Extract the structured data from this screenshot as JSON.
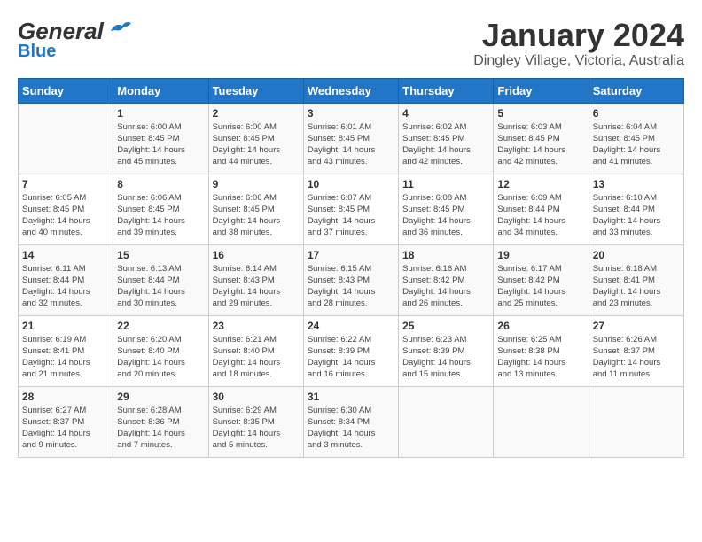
{
  "header": {
    "logo_general": "General",
    "logo_blue": "Blue",
    "month": "January 2024",
    "location": "Dingley Village, Victoria, Australia"
  },
  "weekdays": [
    "Sunday",
    "Monday",
    "Tuesday",
    "Wednesday",
    "Thursday",
    "Friday",
    "Saturday"
  ],
  "weeks": [
    [
      {
        "day": "",
        "content": ""
      },
      {
        "day": "1",
        "content": "Sunrise: 6:00 AM\nSunset: 8:45 PM\nDaylight: 14 hours\nand 45 minutes."
      },
      {
        "day": "2",
        "content": "Sunrise: 6:00 AM\nSunset: 8:45 PM\nDaylight: 14 hours\nand 44 minutes."
      },
      {
        "day": "3",
        "content": "Sunrise: 6:01 AM\nSunset: 8:45 PM\nDaylight: 14 hours\nand 43 minutes."
      },
      {
        "day": "4",
        "content": "Sunrise: 6:02 AM\nSunset: 8:45 PM\nDaylight: 14 hours\nand 42 minutes."
      },
      {
        "day": "5",
        "content": "Sunrise: 6:03 AM\nSunset: 8:45 PM\nDaylight: 14 hours\nand 42 minutes."
      },
      {
        "day": "6",
        "content": "Sunrise: 6:04 AM\nSunset: 8:45 PM\nDaylight: 14 hours\nand 41 minutes."
      }
    ],
    [
      {
        "day": "7",
        "content": "Sunrise: 6:05 AM\nSunset: 8:45 PM\nDaylight: 14 hours\nand 40 minutes."
      },
      {
        "day": "8",
        "content": "Sunrise: 6:06 AM\nSunset: 8:45 PM\nDaylight: 14 hours\nand 39 minutes."
      },
      {
        "day": "9",
        "content": "Sunrise: 6:06 AM\nSunset: 8:45 PM\nDaylight: 14 hours\nand 38 minutes."
      },
      {
        "day": "10",
        "content": "Sunrise: 6:07 AM\nSunset: 8:45 PM\nDaylight: 14 hours\nand 37 minutes."
      },
      {
        "day": "11",
        "content": "Sunrise: 6:08 AM\nSunset: 8:45 PM\nDaylight: 14 hours\nand 36 minutes."
      },
      {
        "day": "12",
        "content": "Sunrise: 6:09 AM\nSunset: 8:44 PM\nDaylight: 14 hours\nand 34 minutes."
      },
      {
        "day": "13",
        "content": "Sunrise: 6:10 AM\nSunset: 8:44 PM\nDaylight: 14 hours\nand 33 minutes."
      }
    ],
    [
      {
        "day": "14",
        "content": "Sunrise: 6:11 AM\nSunset: 8:44 PM\nDaylight: 14 hours\nand 32 minutes."
      },
      {
        "day": "15",
        "content": "Sunrise: 6:13 AM\nSunset: 8:44 PM\nDaylight: 14 hours\nand 30 minutes."
      },
      {
        "day": "16",
        "content": "Sunrise: 6:14 AM\nSunset: 8:43 PM\nDaylight: 14 hours\nand 29 minutes."
      },
      {
        "day": "17",
        "content": "Sunrise: 6:15 AM\nSunset: 8:43 PM\nDaylight: 14 hours\nand 28 minutes."
      },
      {
        "day": "18",
        "content": "Sunrise: 6:16 AM\nSunset: 8:42 PM\nDaylight: 14 hours\nand 26 minutes."
      },
      {
        "day": "19",
        "content": "Sunrise: 6:17 AM\nSunset: 8:42 PM\nDaylight: 14 hours\nand 25 minutes."
      },
      {
        "day": "20",
        "content": "Sunrise: 6:18 AM\nSunset: 8:41 PM\nDaylight: 14 hours\nand 23 minutes."
      }
    ],
    [
      {
        "day": "21",
        "content": "Sunrise: 6:19 AM\nSunset: 8:41 PM\nDaylight: 14 hours\nand 21 minutes."
      },
      {
        "day": "22",
        "content": "Sunrise: 6:20 AM\nSunset: 8:40 PM\nDaylight: 14 hours\nand 20 minutes."
      },
      {
        "day": "23",
        "content": "Sunrise: 6:21 AM\nSunset: 8:40 PM\nDaylight: 14 hours\nand 18 minutes."
      },
      {
        "day": "24",
        "content": "Sunrise: 6:22 AM\nSunset: 8:39 PM\nDaylight: 14 hours\nand 16 minutes."
      },
      {
        "day": "25",
        "content": "Sunrise: 6:23 AM\nSunset: 8:39 PM\nDaylight: 14 hours\nand 15 minutes."
      },
      {
        "day": "26",
        "content": "Sunrise: 6:25 AM\nSunset: 8:38 PM\nDaylight: 14 hours\nand 13 minutes."
      },
      {
        "day": "27",
        "content": "Sunrise: 6:26 AM\nSunset: 8:37 PM\nDaylight: 14 hours\nand 11 minutes."
      }
    ],
    [
      {
        "day": "28",
        "content": "Sunrise: 6:27 AM\nSunset: 8:37 PM\nDaylight: 14 hours\nand 9 minutes."
      },
      {
        "day": "29",
        "content": "Sunrise: 6:28 AM\nSunset: 8:36 PM\nDaylight: 14 hours\nand 7 minutes."
      },
      {
        "day": "30",
        "content": "Sunrise: 6:29 AM\nSunset: 8:35 PM\nDaylight: 14 hours\nand 5 minutes."
      },
      {
        "day": "31",
        "content": "Sunrise: 6:30 AM\nSunset: 8:34 PM\nDaylight: 14 hours\nand 3 minutes."
      },
      {
        "day": "",
        "content": ""
      },
      {
        "day": "",
        "content": ""
      },
      {
        "day": "",
        "content": ""
      }
    ]
  ]
}
